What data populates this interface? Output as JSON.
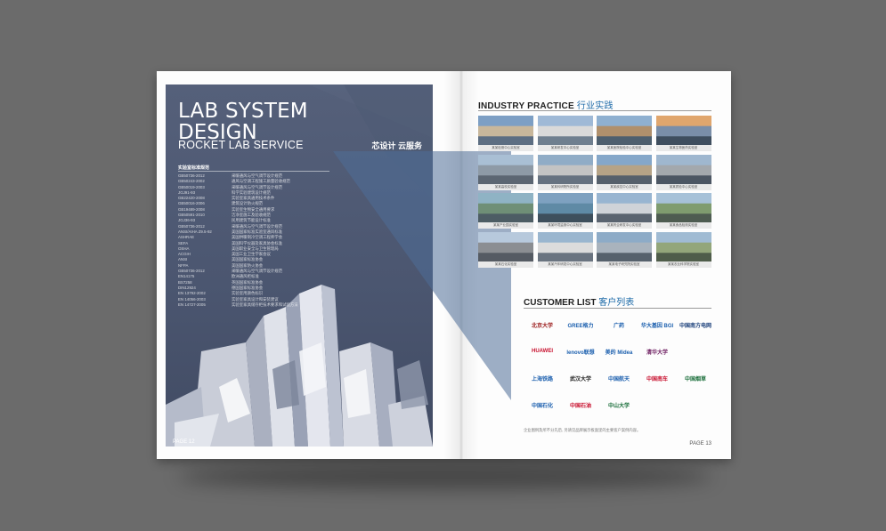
{
  "cover": {
    "title_line1": "LAB SYSTEM",
    "title_line2": "DESIGN",
    "subtitle": "ROCKET LAB SERVICE",
    "tagline": "芯设计 云服务",
    "standards_heading": "实验室标准规范",
    "standards": [
      {
        "code": "GB50736-2012",
        "desc": "采暖通风与空气调节设计规范"
      },
      {
        "code": "GB50243-2002",
        "desc": "通风与空调工程施工质量验收规范"
      },
      {
        "code": "GB50019-2003",
        "desc": "采暖通风与空气调节设计规范"
      },
      {
        "code": "JGJ91-93",
        "desc": "科学实验建筑设计规范"
      },
      {
        "code": "GB22420-2008",
        "desc": "实验室家具通用技术条件"
      },
      {
        "code": "GB50016-2006",
        "desc": "建筑设计防火规范"
      },
      {
        "code": "GB19489-2008",
        "desc": "实验室生物安全通用要求"
      },
      {
        "code": "GB50591-2010",
        "desc": "洁净室施工及验收规范"
      },
      {
        "code": "JGJ36-93",
        "desc": "民用建筑节能设计标准"
      },
      {
        "code": "GB50736-2012",
        "desc": "采暖通风与空气调节设计规范"
      },
      {
        "code": "ANSI/AIHA Z9.5-92",
        "desc": "美国国家标准实验室通风标准"
      },
      {
        "code": "ASHRAE",
        "desc": "美国供暖制冷空调工程师学会"
      },
      {
        "code": "SEFA",
        "desc": "美国科学仪器及家具协会标准"
      },
      {
        "code": "OSHA",
        "desc": "美国职业安全与卫生管理局"
      },
      {
        "code": "ACGIH",
        "desc": "美国工业卫生学家会议"
      },
      {
        "code": "ANSI",
        "desc": "美国国家标准协会"
      },
      {
        "code": "NFPA",
        "desc": "美国国家防火协会"
      },
      {
        "code": "GB50736-2012",
        "desc": "采暖通风与空气调节设计规范"
      },
      {
        "code": "EN14175",
        "desc": "欧洲通风柜标准"
      },
      {
        "code": "BS7258",
        "desc": "英国国家标准协会"
      },
      {
        "code": "DIN12924",
        "desc": "德国国家标准协会"
      },
      {
        "code": "EN 13792-2002",
        "desc": "实验室用颜色标识"
      },
      {
        "code": "EN 14056-2003",
        "desc": "实验室家具设计和安装建议"
      },
      {
        "code": "EN 14727-2005",
        "desc": "实验室家具储存柜技术要求和试验方法"
      }
    ],
    "page_label": "PAGE 12"
  },
  "industry": {
    "title_en": "INDUSTRY PRACTICE",
    "title_cn": "行业实践",
    "captions": [
      "某某检测中心实验室",
      "某某研发中心实验室",
      "某某医院检验中心实验室",
      "某某生物医药实验室",
      "某某高校实验室",
      "某某科研院所实验室",
      "某某疾控中心实验室",
      "某某质检中心实验室",
      "某某产业园实验室",
      "某某环境监测中心实验室",
      "某某药企研发中心实验室",
      "某某食品检测实验室",
      "某某石化实验室",
      "某某汽车研发中心实验室",
      "某某电子研究院实验室",
      "某某农业科学院实验室"
    ]
  },
  "customers": {
    "title_en": "CUSTOMER LIST",
    "title_cn": "客户列表",
    "logos": [
      "北京大学",
      "GREE格力",
      "广药",
      "华大基因 BGI",
      "中国南方电网",
      "HUAWEI",
      "lenovo联想",
      "美的 Midea",
      "清华大学",
      "上海铁路",
      "武汉大学",
      "中国航天",
      "中国南车",
      "中国烟草",
      "中国石化",
      "中国石油",
      "中山大学"
    ],
    "note": "企业图例及所不分先后, 另请见品牌展示板面里的主要客户案例内容。",
    "page_label": "PAGE 13"
  }
}
